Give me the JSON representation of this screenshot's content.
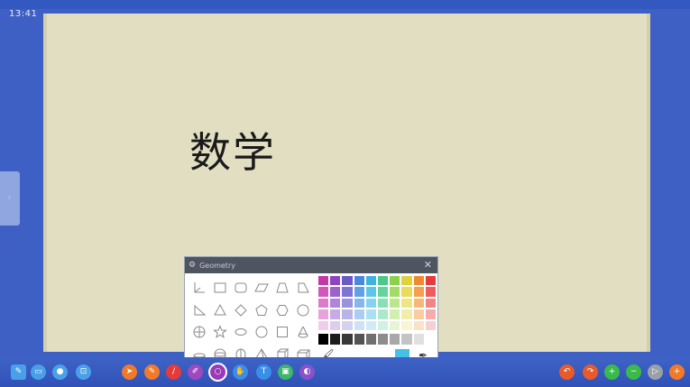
{
  "status": {
    "clock": "13:41"
  },
  "board": {
    "text": "数学"
  },
  "picker": {
    "title": "Geometry",
    "shapes": [
      "axes",
      "rectangle",
      "rounded-rectangle",
      "parallelogram",
      "trapezoid",
      "right-trapezoid",
      "right-triangle",
      "triangle",
      "diamond",
      "pentagon",
      "hexagon",
      "circle",
      "cross",
      "star",
      "ellipse",
      "circle-outline",
      "square",
      "cone",
      "hemisphere",
      "sphere",
      "cylinder-side",
      "pyramid",
      "cube",
      "cuboid"
    ],
    "palette": [
      [
        "#c23aa8",
        "#8e44c0",
        "#6a5ac8",
        "#4a88e0",
        "#3fb3e0",
        "#49c98a",
        "#8bd24a",
        "#e0d23a",
        "#f08a30",
        "#e83a3a"
      ],
      [
        "#d058b8",
        "#9c62cc",
        "#7e74d2",
        "#62a0e6",
        "#5ec4e8",
        "#64d49c",
        "#a2dc66",
        "#e8dc5a",
        "#f4a050",
        "#ee5c5c"
      ],
      [
        "#dc7cc8",
        "#b084d8",
        "#9a92dc",
        "#86b6ec",
        "#84d2ee",
        "#88dfb4",
        "#bce68c",
        "#eee684",
        "#f6b878",
        "#f28484"
      ],
      [
        "#e8a4da",
        "#c8aae4",
        "#b8b4e6",
        "#acccf2",
        "#aae0f2",
        "#ace8cc",
        "#d2eeb0",
        "#f2eeaa",
        "#f8cea0",
        "#f6acac"
      ],
      [
        "#f2cdea",
        "#dccdee",
        "#d4d2f0",
        "#d0e0f6",
        "#cfecf6",
        "#d0f2e2",
        "#e6f6d4",
        "#f8f6d2",
        "#fae2c8",
        "#f8d0d0"
      ]
    ],
    "grays": [
      "#000000",
      "#1c1c1c",
      "#383838",
      "#545454",
      "#707070",
      "#8c8c8c",
      "#a8a8a8",
      "#c4c4c4",
      "#e0e0e0",
      "#ffffff"
    ],
    "current_color": "#45c0e6",
    "fill_icon": "paint-bucket-icon",
    "picker_icon": "eyedropper-icon"
  },
  "toolbar": {
    "left": [
      {
        "name": "edit-icon",
        "color": "#4aa0e8",
        "glyph": "✎",
        "square": true
      },
      {
        "name": "window-icon",
        "color": "#4aa0e8",
        "glyph": "▭",
        "square": false
      },
      {
        "name": "record-icon",
        "color": "#4aa0e8",
        "glyph": "●",
        "square": false
      },
      {
        "name": "screen-icon",
        "color": "#4aa0e8",
        "glyph": "⊡",
        "square": false
      }
    ],
    "center": [
      {
        "name": "pointer-icon",
        "color": "#f07a2a",
        "glyph": "➤"
      },
      {
        "name": "pen-icon",
        "color": "#f07a2a",
        "glyph": "✎"
      },
      {
        "name": "highlighter-icon",
        "color": "#e43a3a",
        "glyph": "/"
      },
      {
        "name": "marker-icon",
        "color": "#a048c0",
        "glyph": "✐"
      },
      {
        "name": "shape-icon",
        "color": "#9a3ab8",
        "glyph": "○",
        "selected": true
      },
      {
        "name": "hand-icon",
        "color": "#3a8ee8",
        "glyph": "✋"
      },
      {
        "name": "text-icon",
        "color": "#3a8ee8",
        "glyph": "T"
      },
      {
        "name": "image-icon",
        "color": "#3ab86a",
        "glyph": "▣"
      },
      {
        "name": "eraser-icon",
        "color": "#8a52c8",
        "glyph": "◐"
      }
    ],
    "right": [
      {
        "name": "undo-icon",
        "color": "#e85a2a",
        "glyph": "↶"
      },
      {
        "name": "redo-icon",
        "color": "#e85a2a",
        "glyph": "↷"
      },
      {
        "name": "zoom-in-icon",
        "color": "#3aba4a",
        "glyph": "+"
      },
      {
        "name": "zoom-out-icon",
        "color": "#3aba4a",
        "glyph": "−"
      },
      {
        "name": "page-icon",
        "color": "#9aa0a8",
        "glyph": "▷"
      },
      {
        "name": "add-page-icon",
        "color": "#f07a2a",
        "glyph": "+"
      }
    ]
  }
}
